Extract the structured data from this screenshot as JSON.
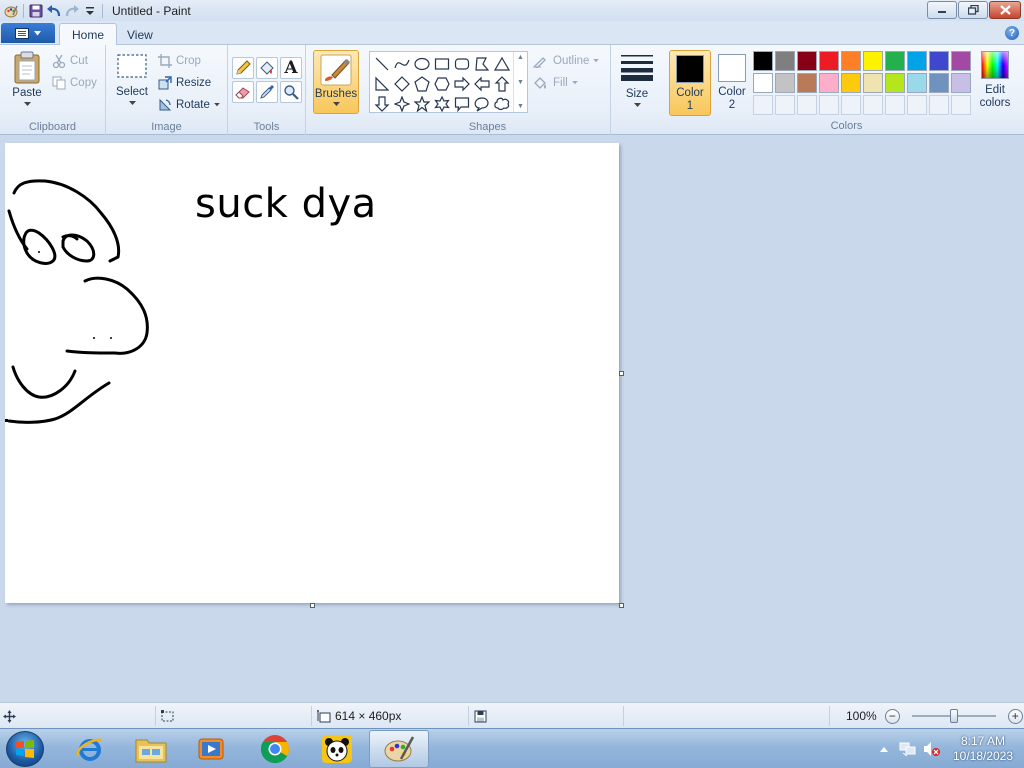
{
  "window": {
    "title": "Untitled - Paint"
  },
  "tabs": {
    "home": "Home",
    "view": "View"
  },
  "help": "?",
  "clipboard": {
    "paste": "Paste",
    "cut": "Cut",
    "copy": "Copy",
    "group": "Clipboard"
  },
  "image": {
    "select": "Select",
    "crop": "Crop",
    "resize": "Resize",
    "rotate": "Rotate",
    "group": "Image"
  },
  "tools": {
    "group": "Tools",
    "text_glyph": "A"
  },
  "brushes": {
    "label": "Brushes"
  },
  "shapes": {
    "group": "Shapes",
    "outline": "Outline",
    "fill": "Fill"
  },
  "size": {
    "label": "Size"
  },
  "colors": {
    "group": "Colors",
    "color1_top": "Color",
    "color1_bottom": "1",
    "color2_top": "Color",
    "color2_bottom": "2",
    "color1_value": "#000000",
    "color2_value": "#ffffff",
    "edit_top": "Edit",
    "edit_bottom": "colors",
    "palette_row1": [
      "#000000",
      "#7f7f7f",
      "#880015",
      "#ed1c24",
      "#ff7f27",
      "#fff200",
      "#22b14c",
      "#00a2e8",
      "#3f48cc",
      "#a349a4"
    ],
    "palette_row2": [
      "#ffffff",
      "#c3c3c3",
      "#b97a57",
      "#ffaec9",
      "#ffc90e",
      "#efe4b0",
      "#b5e61d",
      "#99d9ea",
      "#7092be",
      "#c8bfe7"
    ]
  },
  "canvas": {
    "text": "suck dya"
  },
  "status": {
    "dimensions": "614 × 460px",
    "zoom": "100%"
  },
  "clock": {
    "time": "8:17 AM",
    "date": "10/18/2023"
  }
}
